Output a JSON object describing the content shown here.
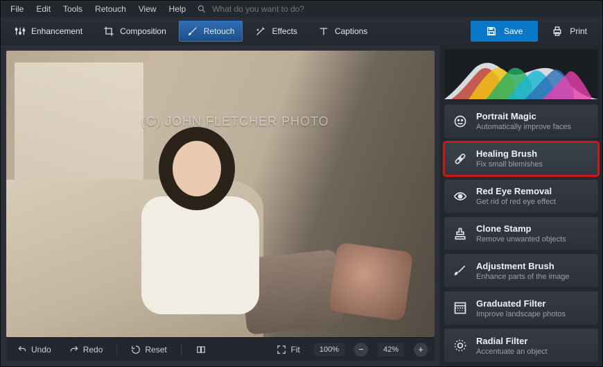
{
  "menu": {
    "items": [
      "File",
      "Edit",
      "Tools",
      "Retouch",
      "View",
      "Help"
    ],
    "search_placeholder": "What do you want to do?"
  },
  "toolbar": {
    "tabs": [
      {
        "label": "Enhancement",
        "icon": "sliders-icon"
      },
      {
        "label": "Composition",
        "icon": "crop-icon"
      },
      {
        "label": "Retouch",
        "icon": "brush-icon",
        "active": true
      },
      {
        "label": "Effects",
        "icon": "wand-icon"
      },
      {
        "label": "Captions",
        "icon": "text-icon"
      }
    ],
    "save_label": "Save",
    "print_label": "Print"
  },
  "canvas": {
    "watermark": "(C) JOHN FLETCHER PHOTO"
  },
  "retouch_tools": [
    {
      "icon": "face-icon",
      "title": "Portrait Magic",
      "desc": "Automatically improve faces"
    },
    {
      "icon": "bandage-icon",
      "title": "Healing Brush",
      "desc": "Fix small blemishes",
      "selected": true
    },
    {
      "icon": "eye-icon",
      "title": "Red Eye Removal",
      "desc": "Get rid of red eye effect"
    },
    {
      "icon": "stamp-icon",
      "title": "Clone Stamp",
      "desc": "Remove unwanted objects"
    },
    {
      "icon": "adjust-brush-icon",
      "title": "Adjustment Brush",
      "desc": "Enhance parts of the image"
    },
    {
      "icon": "gradient-icon",
      "title": "Graduated Filter",
      "desc": "Improve landscape photos"
    },
    {
      "icon": "radial-icon",
      "title": "Radial Filter",
      "desc": "Accentuate an object"
    }
  ],
  "bottom": {
    "undo_label": "Undo",
    "redo_label": "Redo",
    "reset_label": "Reset",
    "fit_label": "Fit",
    "zoom_100": "100%",
    "zoom_current": "42%"
  }
}
